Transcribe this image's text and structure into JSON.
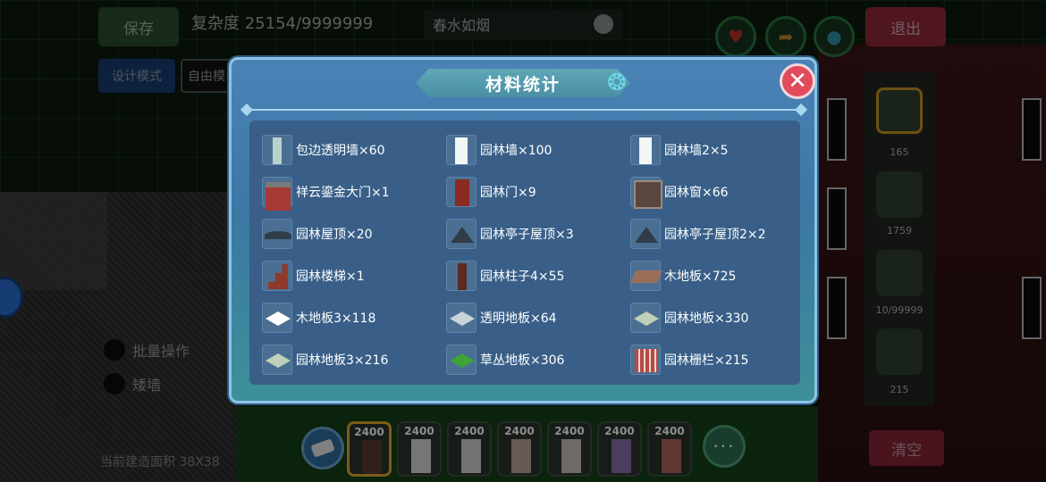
{
  "hud": {
    "save_label": "保存",
    "complexity_label": "复杂度 25154/9999999",
    "build_name": "春水如烟",
    "exit_label": "退出",
    "design_mode_label": "设计模式",
    "free_mode_label": "自由模",
    "batch_label": "批量操作",
    "short_wall_label": "矮墙",
    "area_label": "当前建造面积 38X38",
    "clear_label": "清空",
    "side_counts": [
      "165",
      "1759",
      "10/99999",
      "215"
    ],
    "hotbar_counts": [
      "2400",
      "2400",
      "2400",
      "2400",
      "2400",
      "2400",
      "2400"
    ],
    "more_label": "···",
    "icons": [
      "heart-icon",
      "share-icon",
      "water-icon",
      "gear-icon",
      "eraser-icon"
    ]
  },
  "dialog": {
    "title": "材料统计",
    "items": [
      {
        "label": "包边透明墙×60",
        "icon": "transparent-wall-icon"
      },
      {
        "label": "园林墙×100",
        "icon": "garden-wall-icon"
      },
      {
        "label": "园林墙2×5",
        "icon": "garden-wall-icon"
      },
      {
        "label": "祥云鎏金大门×1",
        "icon": "gate-icon"
      },
      {
        "label": "园林门×9",
        "icon": "door-icon"
      },
      {
        "label": "园林窗×66",
        "icon": "window-icon"
      },
      {
        "label": "园林屋顶×20",
        "icon": "roof-icon"
      },
      {
        "label": "园林亭子屋顶×3",
        "icon": "pavilion-roof-icon"
      },
      {
        "label": "园林亭子屋顶2×2",
        "icon": "pavilion-roof-icon"
      },
      {
        "label": "园林楼梯×1",
        "icon": "stairs-icon"
      },
      {
        "label": "园林柱子4×55",
        "icon": "pillar-icon"
      },
      {
        "label": "木地板×725",
        "icon": "wood-floor-icon"
      },
      {
        "label": "木地板3×118",
        "icon": "white-floor-icon"
      },
      {
        "label": "透明地板×64",
        "icon": "glass-floor-icon"
      },
      {
        "label": "园林地板×330",
        "icon": "garden-floor-icon"
      },
      {
        "label": "园林地板3×216",
        "icon": "garden-floor-icon"
      },
      {
        "label": "草丛地板×306",
        "icon": "grass-floor-icon"
      },
      {
        "label": "园林栅栏×215",
        "icon": "fence-icon"
      }
    ]
  }
}
